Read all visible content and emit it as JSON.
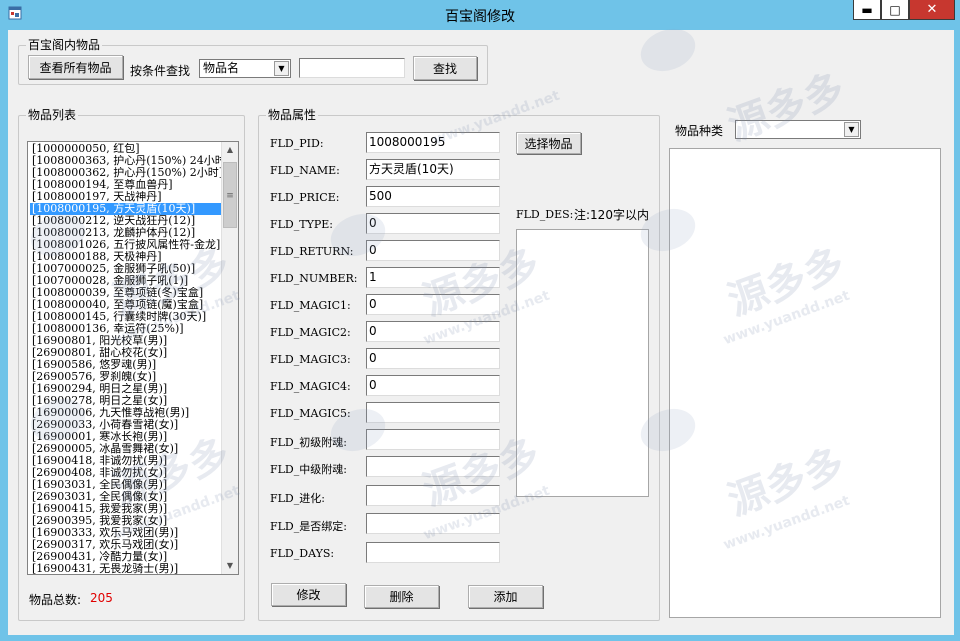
{
  "window": {
    "title": "百宝阁修改",
    "minimize_glyph": "▬",
    "maximize_glyph": "□",
    "close_glyph": "✕"
  },
  "top_group": {
    "title": "百宝阁内物品",
    "view_all_button": "查看所有物品",
    "search_label": "按条件查找",
    "condition_value": "物品名",
    "search_value": "",
    "search_button": "查找"
  },
  "list_group": {
    "title": "物品列表",
    "items": [
      "[1000000050, 红包]",
      "[1008000363, 护心丹(150%) 24小时]",
      "[1008000362, 护心丹(150%) 2小时]",
      "[1008000194, 至尊血兽丹]",
      "[1008000197, 天战神丹]",
      "[1008000195, 方天灵盾(10天)]",
      "[1008000212, 逆天战狂丹(12)]",
      "[1008000213, 龙麟护体丹(12)]",
      "[1008001026, 五行披风属性符-金龙]",
      "[1008000188, 天极神丹]",
      "[1007000025, 金服狮子吼(50)]",
      "[1007000028, 金服狮子吼(1)]",
      "[1008000039, 至尊项链(冬)宝盒]",
      "[1008000040, 至尊项链(魔)宝盒]",
      "[1008000145, 行囊续时牌(30天)]",
      "[1008000136, 幸运符(25%)]",
      "[16900801, 阳光校草(男)]",
      "[26900801, 甜心校花(女)]",
      "[16900586, 悠罗魂(男)]",
      "[26900576, 罗刹魄(女)]",
      "[16900294, 明日之星(男)]",
      "[16900278, 明日之星(女)]",
      "[16900006, 九天惟尊战袍(男)]",
      "[26900033, 小荷春雪裙(女)]",
      "[16900001, 寒冰长袍(男)]",
      "[26900005, 冰晶雪舞裙(女)]",
      "[16900418, 非诚勿扰(男)]",
      "[26900408, 非诚勿扰(女)]",
      "[16903031, 全民偶像(男)]",
      "[26903031, 全民偶像(女)]",
      "[16900415, 我爱我家(男)]",
      "[26900395, 我爱我家(女)]",
      "[16900333, 欢乐马戏团(男)]",
      "[26900317, 欢乐马戏团(女)]",
      "[26900431, 冷酷力量(女)]",
      "[16900431, 无畏龙骑士(男)]"
    ],
    "selected_index": 5,
    "total_label": "物品总数:",
    "total_value": "205"
  },
  "attr_group": {
    "title": "物品属性",
    "fields": [
      {
        "label": "FLD_PID:",
        "value": "1008000195"
      },
      {
        "label": "FLD_NAME:",
        "value": "方天灵盾(10天)"
      },
      {
        "label": "FLD_PRICE:",
        "value": "500"
      },
      {
        "label": "FLD_TYPE:",
        "value": "0"
      },
      {
        "label": "FLD_RETURN:",
        "value": "0"
      },
      {
        "label": "FLD_NUMBER:",
        "value": "1"
      },
      {
        "label": "FLD_MAGIC1:",
        "value": "0"
      },
      {
        "label": "FLD_MAGIC2:",
        "value": "0"
      },
      {
        "label": "FLD_MAGIC3:",
        "value": "0"
      },
      {
        "label": "FLD_MAGIC4:",
        "value": "0"
      },
      {
        "label": "FLD_MAGIC5:",
        "value": ""
      },
      {
        "label": "FLD_初级附魂:",
        "value": ""
      },
      {
        "label": "FLD_中级附魂:",
        "value": ""
      },
      {
        "label": "FLD_进化:",
        "value": ""
      },
      {
        "label": "FLD_是否绑定:",
        "value": ""
      },
      {
        "label": "FLD_DAYS:",
        "value": ""
      }
    ],
    "select_item_button": "选择物品",
    "des_label": "FLD_DES:",
    "des_note": "注:120字以内",
    "des_value": "",
    "modify_button": "修改",
    "delete_button": "删除",
    "add_button": "添加"
  },
  "category": {
    "label": "物品种类",
    "value": ""
  },
  "watermark": {
    "brand": "源多多",
    "url": "www.yuandd.net",
    "small": "YUANDD.NET"
  },
  "colors": {
    "title_bar": "#6fc3e8",
    "selection": "#3399ff",
    "total_value": "#e00000",
    "close_button": "#c7372f"
  }
}
